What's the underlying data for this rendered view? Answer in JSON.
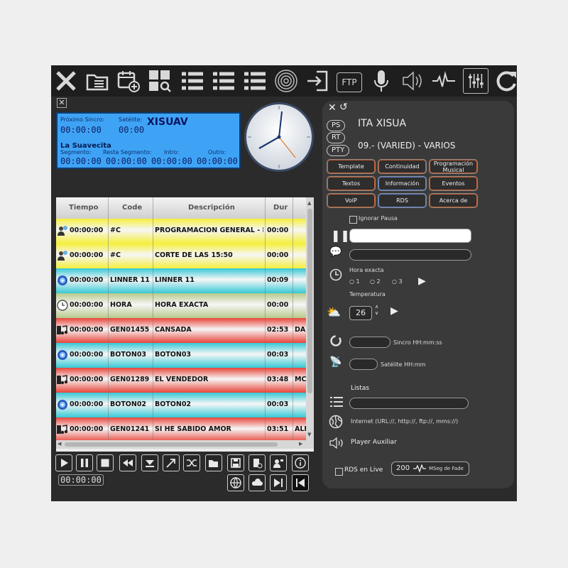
{
  "toolbar": {
    "icons": [
      "close-icon",
      "playlist-folder-icon",
      "calendar-add-icon",
      "grid-search-icon",
      "list-icon",
      "list-icon",
      "list-icon",
      "tunnel-icon",
      "login-icon",
      "ftp-icon",
      "microphone-icon",
      "speaker-icon",
      "waveform-icon",
      "mixer-icon",
      "refresh-icon"
    ],
    "ftp_label": "FTP"
  },
  "lcd": {
    "next_sync_label": "Próximo Sincro:",
    "satellite_label": "Satélite:",
    "station": "XISUAV",
    "next_sync_value": "00:00:00",
    "satellite_value": "00:00",
    "now_playing": "La Suavecita",
    "segment_label": "Segmento:",
    "remaining_label": "Resta Segmento:",
    "intro_label": "Intro:",
    "outro_label": "Outro:",
    "segment_value": "00:00:00",
    "remaining_value": "00:00:00",
    "intro_value": "00:00:00",
    "outro_value": "00:00:00"
  },
  "table": {
    "columns": [
      "Tiempo",
      "Code",
      "Descripción",
      "Dur"
    ],
    "rows": [
      {
        "time": "00:00:00",
        "code": "#C",
        "desc": "PROGRAMACION GENERAL - EM",
        "dur": "00:00",
        "extra": "",
        "icon": "user-icon",
        "color": "#f5ef3c"
      },
      {
        "time": "00:00:00",
        "code": "#C",
        "desc": "CORTE DE LAS 15:50",
        "dur": "00:00",
        "extra": "",
        "icon": "user-icon",
        "color": "#f5ef3c"
      },
      {
        "time": "00:00:00",
        "code": "LINNER 11",
        "desc": "LINNER 11",
        "dur": "00:09",
        "extra": "",
        "icon": "cd-icon",
        "color": "#36c9d6"
      },
      {
        "time": "00:00:00",
        "code": "HORA",
        "desc": "HORA EXACTA",
        "dur": "00:00",
        "extra": "",
        "icon": "clock-icon",
        "color": "#b7c98a"
      },
      {
        "time": "00:00:00",
        "code": "GEN01455",
        "desc": "CANSADA",
        "dur": "02:53",
        "extra": "DA",
        "icon": "music-icon",
        "color": "#e8453a"
      },
      {
        "time": "00:00:00",
        "code": "BOTON03",
        "desc": "BOTON03",
        "dur": "00:03",
        "extra": "",
        "icon": "cd-icon",
        "color": "#36c9d6"
      },
      {
        "time": "00:00:00",
        "code": "GEN01289",
        "desc": "EL VENDEDOR",
        "dur": "03:48",
        "extra": "MC",
        "icon": "music-icon",
        "color": "#e8453a"
      },
      {
        "time": "00:00:00",
        "code": "BOTON02",
        "desc": "BOTON02",
        "dur": "00:03",
        "extra": "",
        "icon": "cd-icon",
        "color": "#36c9d6"
      },
      {
        "time": "00:00:00",
        "code": "GEN01241",
        "desc": "SI HE SABIDO AMOR",
        "dur": "03:51",
        "extra": "ALI",
        "icon": "music-icon",
        "color": "#e8453a"
      }
    ]
  },
  "transport": {
    "buttons": [
      "play-icon",
      "pause-icon",
      "stop-icon",
      "rewind-icon",
      "down-triangle-icon",
      "arrow-up-right-icon",
      "shuffle-icon",
      "folder-open-icon",
      "save-icon",
      "delete-file-icon",
      "user-voice-icon",
      "info-icon",
      "globe-icon",
      "cloud-icon",
      "next-icon",
      "previous-icon"
    ],
    "counter": "00:00:00"
  },
  "panel": {
    "ps_label": "PS",
    "rt_label": "RT",
    "pty_label": "PTY",
    "ps_value": "ITA XISUA",
    "pty_value": "09.- (VARIED) - VARIOS",
    "buttons": [
      "Template",
      "Continuidad",
      "Programación Musical",
      "Textos",
      "Información",
      "Eventos",
      "VoIP",
      "RDS",
      "Acerca de"
    ],
    "ignore_pause": "Ignorar Pausa",
    "exact_time": "Hora exacta",
    "radio_options": [
      "1",
      "2",
      "3"
    ],
    "temperature_label": "Temperatura",
    "temperature_value": "26",
    "sync_label": "Sincro HH:mm:ss",
    "satellite_label": "Satélite HH:mm",
    "lists_label": "Listas",
    "internet_label": "Internet (URL://, http://, ftp://, mms://)",
    "aux_player": "Player Auxiliar",
    "rds_live": "RDS en Live",
    "fade_value": "200",
    "fade_label": "MSeg de Fade"
  }
}
